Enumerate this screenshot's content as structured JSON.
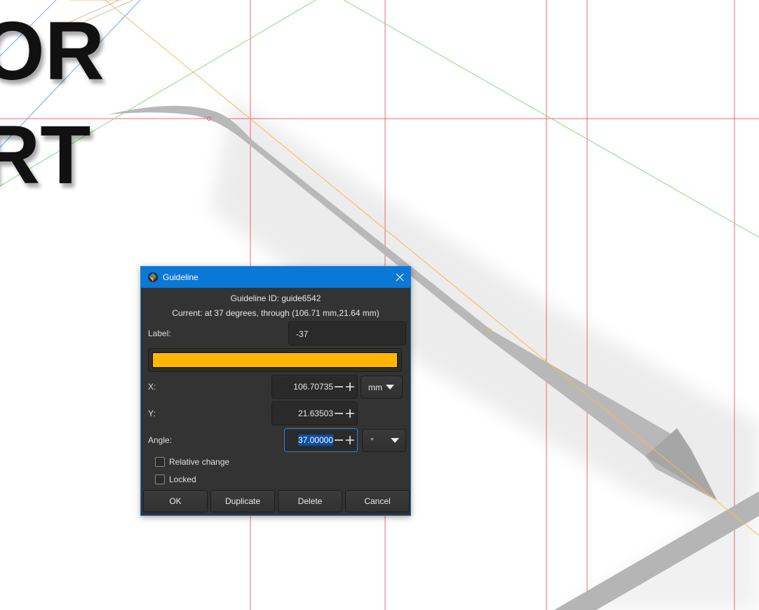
{
  "canvas_text": {
    "line1": "OR",
    "line2": "RT"
  },
  "dialog": {
    "title": "Guideline",
    "app_icon": "inkscape-icon",
    "guideline_id": "Guideline ID: guide6542",
    "current": "Current: at 37 degrees, through (106.71 mm,21.64 mm)",
    "label_caption": "Label:",
    "label_value": "-37",
    "color": "#ffb600",
    "x_caption": "X:",
    "x_value": "106.70735",
    "x_unit": "mm",
    "y_caption": "Y:",
    "y_value": "21.63503",
    "angle_caption": "Angle:",
    "angle_value": "37.00000",
    "angle_unit": "°",
    "relative_change": "Relative change",
    "locked": "Locked",
    "buttons": {
      "ok": "OK",
      "duplicate": "Duplicate",
      "delete": "Delete",
      "cancel": "Cancel"
    }
  },
  "colors": {
    "guide_red": "#e8505a",
    "guide_green": "#7fe07f",
    "guide_orange": "#f5b85c",
    "guide_blue": "#6aa6ff",
    "dialog_bg": "#333333",
    "titlebar": "#0a78d7",
    "selection": "#0a4fa0"
  }
}
